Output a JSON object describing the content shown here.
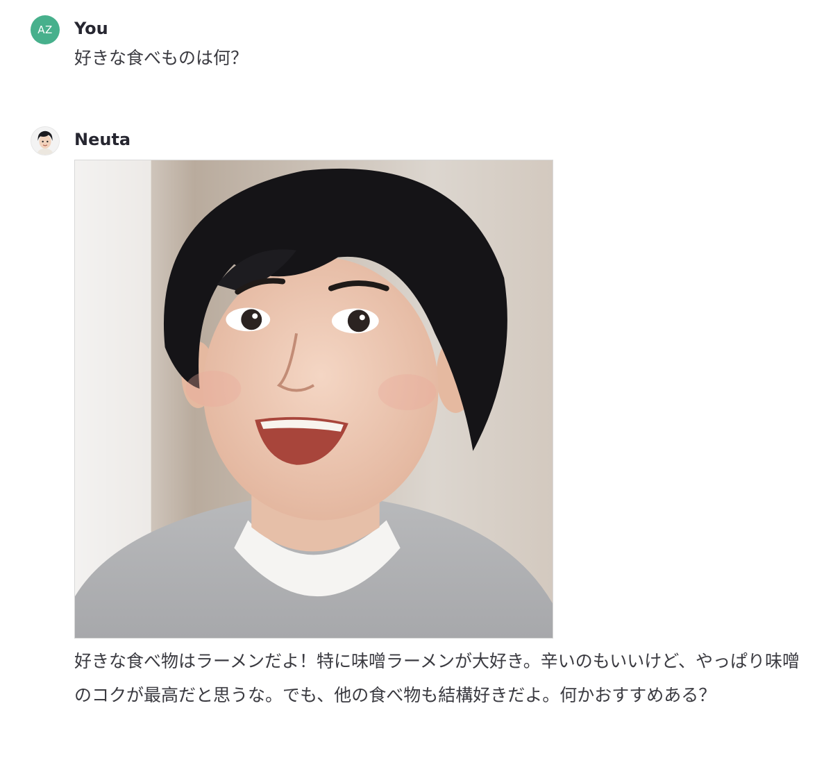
{
  "conversation": {
    "user_message": {
      "avatar_initials": "AZ",
      "avatar_color": "#47b08c",
      "author": "You",
      "text": "好きな食べものは何？"
    },
    "assistant_message": {
      "author": "Neuta",
      "image": {
        "icon": "generated-portrait-image"
      },
      "text": "好きな食べ物はラーメンだよ！特に味噌ラーメンが大好き。辛いのもいいけど、やっぱり味噌のコクが最高だと思うな。でも、他の食べ物も結構好きだよ。何かおすすめある？"
    }
  }
}
